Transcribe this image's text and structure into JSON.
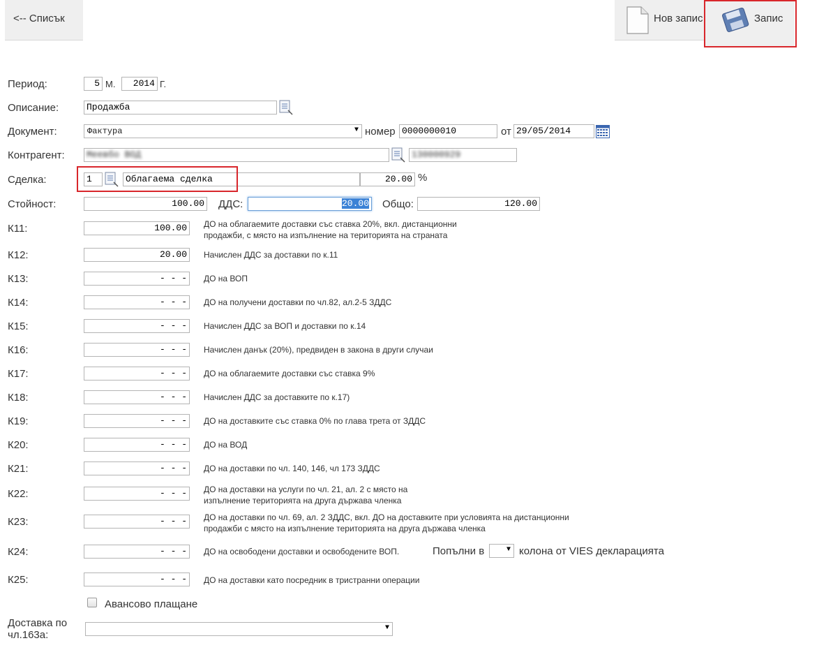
{
  "toolbar": {
    "back_label": "<-- Списък",
    "new_label": "Нов запис",
    "save_label": "Запис"
  },
  "form": {
    "period": {
      "label": "Период:",
      "month": "5",
      "month_suffix": "М.",
      "year": "2014",
      "year_suffix": "Г."
    },
    "description": {
      "label": "Описание:",
      "value": "Продажба"
    },
    "document": {
      "label": "Документ:",
      "type": "Фактура",
      "number_label": "номер",
      "number": "0000000010",
      "date_label": "от",
      "date": "29/05/2014"
    },
    "counterparty": {
      "label": "Контрагент:",
      "name": "Меевбо ВОД",
      "id": "130000929"
    },
    "deal": {
      "label": "Сделка:",
      "code": "1",
      "name": "Облагаема сделка",
      "rate": "20.00",
      "rate_suffix": "%"
    },
    "value": {
      "label": "Стойност:",
      "amount": "100.00",
      "vat_label": "ДДС:",
      "vat": "20.00",
      "total_label": "Общо:",
      "total": "120.00"
    },
    "rows": [
      {
        "label": "К11:",
        "value": "100.00",
        "desc": "ДО на облагаемите доставки със ставка 20%, вкл. дистанционни продажби, с място на изпълнение на територията на страната"
      },
      {
        "label": "К12:",
        "value": "20.00",
        "desc": "Начислен ДДС за доставки по к.11"
      },
      {
        "label": "К13:",
        "value": "- - -",
        "desc": "ДО на ВОП"
      },
      {
        "label": "К14:",
        "value": "- - -",
        "desc": "ДО на получени доставки по чл.82, ал.2-5 ЗДДС"
      },
      {
        "label": "К15:",
        "value": "- - -",
        "desc": "Начислен ДДС за ВОП и доставки по к.14"
      },
      {
        "label": "К16:",
        "value": "- - -",
        "desc": "Начислен данък (20%), предвиден в закона в други случаи"
      },
      {
        "label": "К17:",
        "value": "- - -",
        "desc": "ДО на облагаемите доставки със ставка 9%"
      },
      {
        "label": "К18:",
        "value": "- - -",
        "desc": "Начислен ДДС за доставките по к.17)"
      },
      {
        "label": "К19:",
        "value": "- - -",
        "desc": "ДО на доставките със ставка 0% по глава трета от ЗДДС"
      },
      {
        "label": "К20:",
        "value": "- - -",
        "desc": "ДО на ВОД"
      },
      {
        "label": "К21:",
        "value": "- - -",
        "desc": "ДО на доставки по чл. 140, 146, чл 173 ЗДДС"
      },
      {
        "label": "К22:",
        "value": "- - -",
        "desc": "ДО на доставки на услуги по чл. 21, ал. 2 с място на изпълнение територията на друга държава членка"
      },
      {
        "label": "К23:",
        "value": "- - -",
        "desc": "ДО на доставки по чл. 69, ал. 2 ЗДДС, вкл. ДО на доставките при условията на дистанционни продажби с място на изпълнение територията на друга държава членка"
      },
      {
        "label": "К24:",
        "value": "- - -",
        "desc": "ДО на освободени доставки и освободените ВОП."
      },
      {
        "label": "К25:",
        "value": "- - -",
        "desc": "ДО на доставки като посредник в тристранни операции"
      }
    ],
    "vies": {
      "before": "Попълни в",
      "after": "колона от VIES декларацията"
    },
    "advance": {
      "label": "Авансово плащане"
    },
    "delivery163": {
      "label": "Доставка по чл.163а:"
    }
  }
}
